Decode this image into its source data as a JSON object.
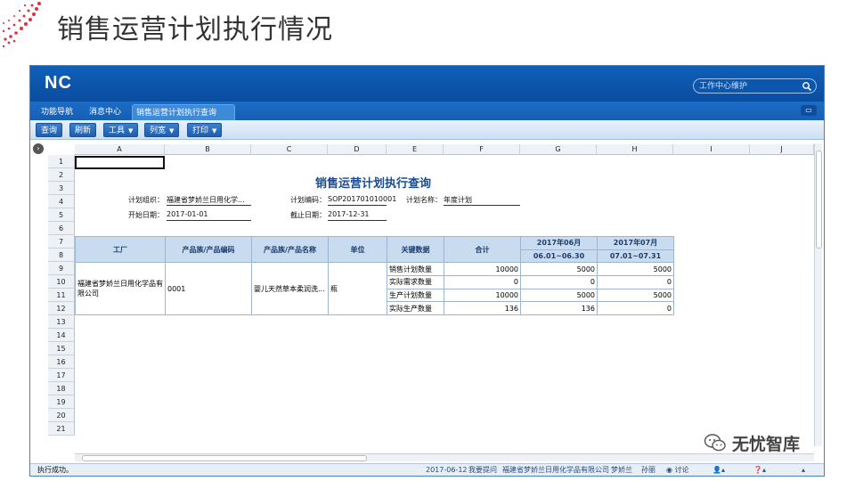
{
  "slide": {
    "title": "销售运营计划执行情况",
    "watermark": "无忧智库"
  },
  "app": {
    "logo": "NC",
    "search": {
      "placeholder": "工作中心维护"
    },
    "tabs": [
      "功能导航",
      "消息中心",
      "销售运营计划执行查询"
    ],
    "toolbar": [
      "查询",
      "刷新",
      "工具",
      "列宽",
      "打印"
    ]
  },
  "sheet": {
    "columns": [
      "A",
      "B",
      "C",
      "D",
      "E",
      "F",
      "G",
      "H",
      "I",
      "J"
    ],
    "rows": [
      "1",
      "2",
      "3",
      "4",
      "5",
      "6",
      "7",
      "8",
      "9",
      "10",
      "11",
      "12",
      "13",
      "14",
      "15",
      "16",
      "17",
      "18",
      "19",
      "20",
      "21"
    ],
    "report": {
      "title": "销售运营计划执行查询",
      "plan_org_label": "计划组织：",
      "plan_org_value": "福建省梦娇兰日用化学...",
      "plan_code_label": "计划编码：",
      "plan_code_value": "SOP201701010001",
      "plan_name_label": "计划名称：",
      "plan_name_value": "年度计划",
      "start_label": "开始日期：",
      "start_value": "2017-01-01",
      "end_label": "截止日期：",
      "end_value": "2017-12-31"
    },
    "table": {
      "headers": [
        "工厂",
        "产品族/产品编码",
        "产品族/产品名称",
        "单位",
        "关键数据",
        "合计"
      ],
      "months": [
        "2017年06月",
        "2017年07月"
      ],
      "ranges": [
        "06.01~06.30",
        "07.01~07.31"
      ],
      "factory": "福建省梦娇兰日用化学品有限公司",
      "code": "0001",
      "name": "婴儿天然草本柔润洗...",
      "unit": "瓶",
      "rows": [
        {
          "key": "销售计划数量",
          "total": "10000",
          "m6": "5000",
          "m7": "5000"
        },
        {
          "key": "实际需求数量",
          "total": "0",
          "m6": "0",
          "m7": "0"
        },
        {
          "key": "生产计划数量",
          "total": "10000",
          "m6": "5000",
          "m7": "5000"
        },
        {
          "key": "实际生产数量",
          "total": "136",
          "m6": "136",
          "m7": "0"
        }
      ]
    }
  },
  "status": {
    "left": "执行成功。",
    "date": "2017-06-12",
    "ask": "我要提问",
    "company": "福建省梦娇兰日用化学品有限公司",
    "user": "梦娇兰",
    "name": "孙丽",
    "discuss": "讨论"
  }
}
